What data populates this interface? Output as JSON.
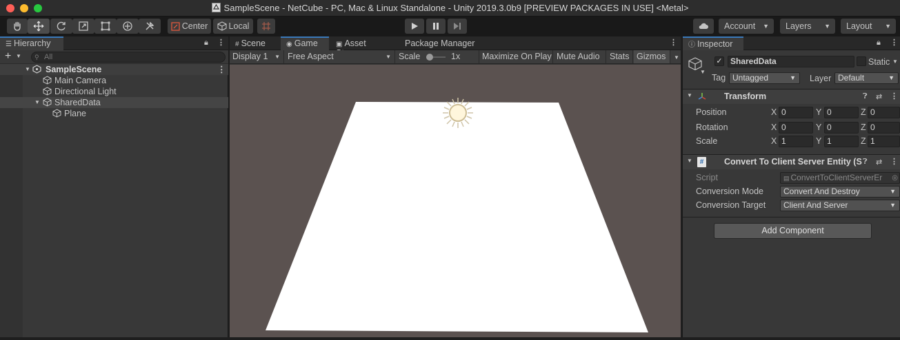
{
  "window": {
    "title": "SampleScene - NetCube - PC, Mac & Linux Standalone - Unity 2019.3.0b9 [PREVIEW PACKAGES IN USE] <Metal>"
  },
  "toolbar": {
    "pivot_label": "Center",
    "space_label": "Local",
    "account_label": "Account",
    "layers_label": "Layers",
    "layout_label": "Layout"
  },
  "hierarchy": {
    "tab_label": "Hierarchy",
    "add_label": "+",
    "search_placeholder": "All",
    "scene_name": "SampleScene",
    "items": [
      {
        "label": "Main Camera"
      },
      {
        "label": "Directional Light"
      },
      {
        "label": "SharedData"
      },
      {
        "label": "Plane"
      }
    ]
  },
  "center_tabs": [
    {
      "label": "Scene"
    },
    {
      "label": "Game"
    },
    {
      "label": "Asset Store"
    },
    {
      "label": "Package Manager"
    }
  ],
  "game_toolbar": {
    "display": "Display 1",
    "aspect": "Free Aspect",
    "scale_label": "Scale",
    "scale_value": "1x",
    "maximize": "Maximize On Play",
    "mute": "Mute Audio",
    "stats": "Stats",
    "gizmos": "Gizmos"
  },
  "inspector": {
    "tab_label": "Inspector",
    "object_name": "SharedData",
    "static_label": "Static",
    "tag_label": "Tag",
    "tag_value": "Untagged",
    "layer_label": "Layer",
    "layer_value": "Default",
    "transform": {
      "title": "Transform",
      "rows": [
        {
          "label": "Position",
          "x": "0",
          "y": "0",
          "z": "0"
        },
        {
          "label": "Rotation",
          "x": "0",
          "y": "0",
          "z": "0"
        },
        {
          "label": "Scale",
          "x": "1",
          "y": "1",
          "z": "1"
        }
      ],
      "axis_x": "X",
      "axis_y": "Y",
      "axis_z": "Z"
    },
    "convert": {
      "title": "Convert To Client Server Entity (S",
      "script_label": "Script",
      "script_value": "ConvertToClientServerEr",
      "mode_label": "Conversion Mode",
      "mode_value": "Convert And Destroy",
      "target_label": "Conversion Target",
      "target_value": "Client And Server"
    },
    "add_component": "Add Component"
  },
  "colors": {
    "accent": "#3a79bb",
    "viewport_bg": "#5b5250",
    "panel_bg": "#383838"
  }
}
